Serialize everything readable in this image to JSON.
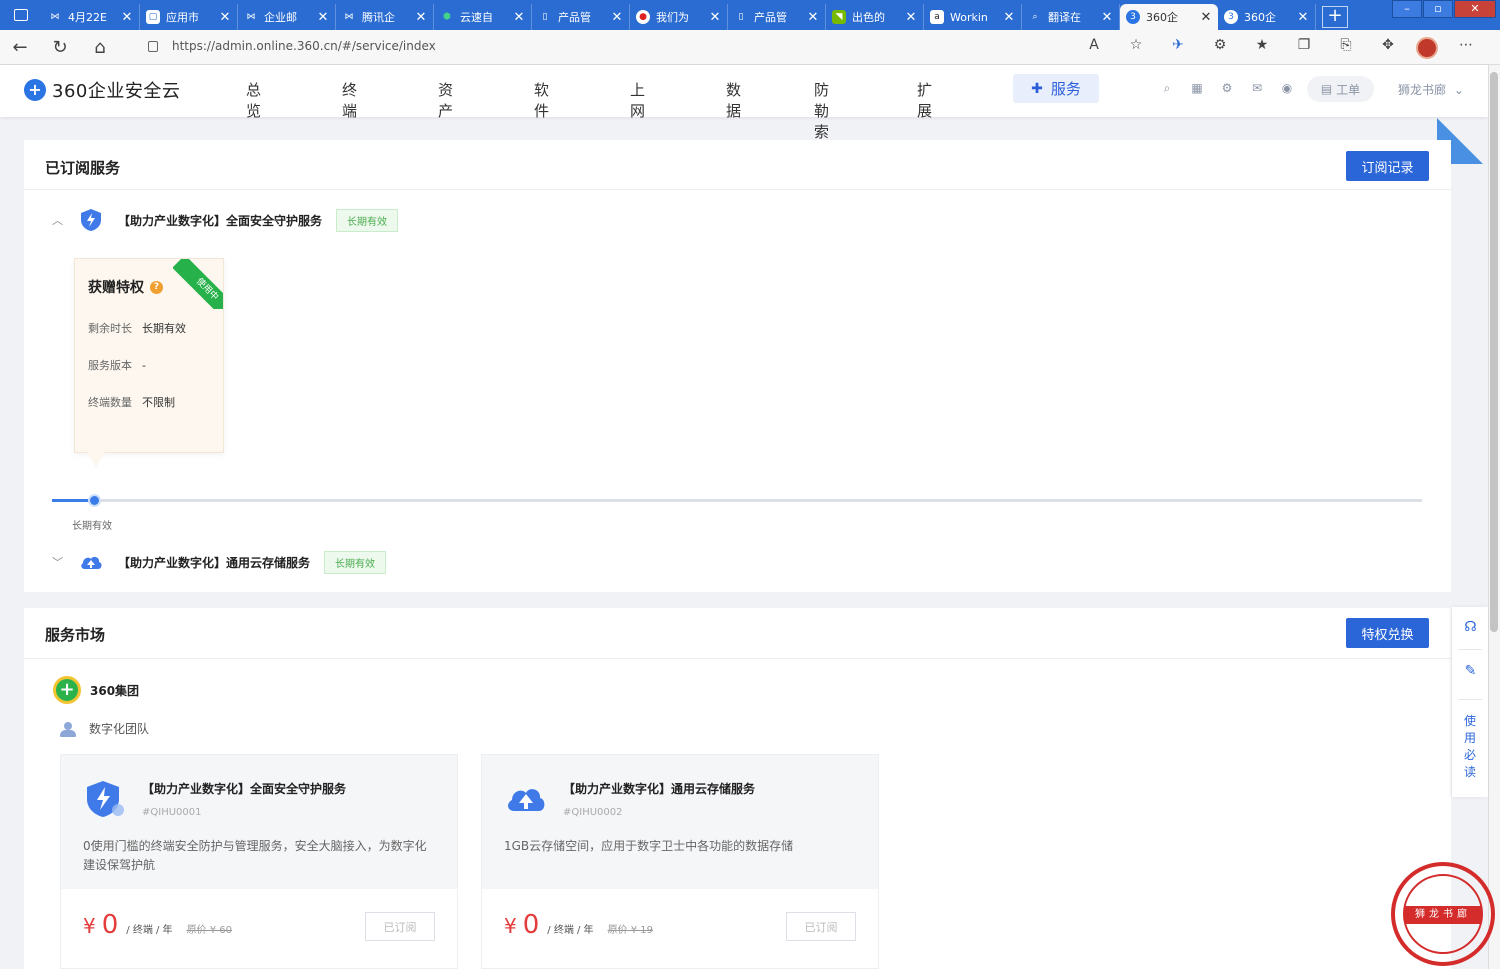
{
  "browser": {
    "tabs": [
      {
        "title": "4月22E",
        "icon": "outlook-icon"
      },
      {
        "title": "应用市",
        "icon": "app-icon"
      },
      {
        "title": "企业邮",
        "icon": "outlook-icon"
      },
      {
        "title": "腾讯企",
        "icon": "outlook-icon"
      },
      {
        "title": "云速自",
        "icon": "cloud-icon"
      },
      {
        "title": "产品管",
        "icon": "page-icon"
      },
      {
        "title": "我们为",
        "icon": "red-icon"
      },
      {
        "title": "产品管",
        "icon": "page-icon"
      },
      {
        "title": "出色的",
        "icon": "nvidia-icon"
      },
      {
        "title": "Workin",
        "icon": "amazon-icon"
      },
      {
        "title": "翻译在",
        "icon": "search-icon"
      },
      {
        "title": "360企",
        "icon": "360-icon",
        "active": true
      },
      {
        "title": "360企",
        "icon": "360-icon"
      }
    ],
    "url": "https://admin.online.360.cn/#/service/index"
  },
  "app": {
    "logo_text": "360企业安全云",
    "nav": [
      "总览",
      "终端",
      "资产",
      "软件",
      "上网",
      "数据",
      "防勒索",
      "扩展"
    ],
    "nav_active": "服务",
    "workorder": "工单",
    "user": "狮龙书廊"
  },
  "subscribed": {
    "title": "已订阅服务",
    "record_button": "订阅记录",
    "services": [
      {
        "name": "【助力产业数字化】全面安全守护服务",
        "badge": "长期有效"
      },
      {
        "name": "【助力产业数字化】通用云存储服务",
        "badge": "长期有效"
      }
    ],
    "privilege": {
      "title": "获赠特权",
      "ribbon": "使用中",
      "rows": [
        {
          "label": "剩余时长",
          "value": "长期有效"
        },
        {
          "label": "服务版本",
          "value": "-"
        },
        {
          "label": "终端数量",
          "value": "不限制"
        }
      ]
    },
    "slider_label": "长期有效"
  },
  "market": {
    "title": "服务市场",
    "exchange_button": "特权兑换",
    "group": "360集团",
    "team": "数字化团队",
    "cards": [
      {
        "name": "【助力产业数字化】全面安全守护服务",
        "code": "#QIHU0001",
        "desc": "0使用门槛的终端安全防护与管理服务，安全大脑接入，为数字化建设保驾护航",
        "currency": "¥",
        "price": "0",
        "unit": "/ 终端 / 年",
        "original": "原价 ¥ 60",
        "status": "已订阅"
      },
      {
        "name": "【助力产业数字化】通用云存储服务",
        "code": "#QIHU0002",
        "desc": "1GB云存储空间，应用于数字卫士中各功能的数据存储",
        "currency": "¥",
        "price": "0",
        "unit": "/ 终端 / 年",
        "original": "原价 ¥ 19",
        "status": "已订阅"
      }
    ]
  },
  "float": {
    "guide": "使用必读"
  },
  "stamp": {
    "text": "狮龙书廊"
  },
  "colors": {
    "primary": "#2b66d9",
    "tabbar": "#2b6cd2",
    "badge_green": "#4aad4e",
    "price_red": "#e43b3b"
  }
}
